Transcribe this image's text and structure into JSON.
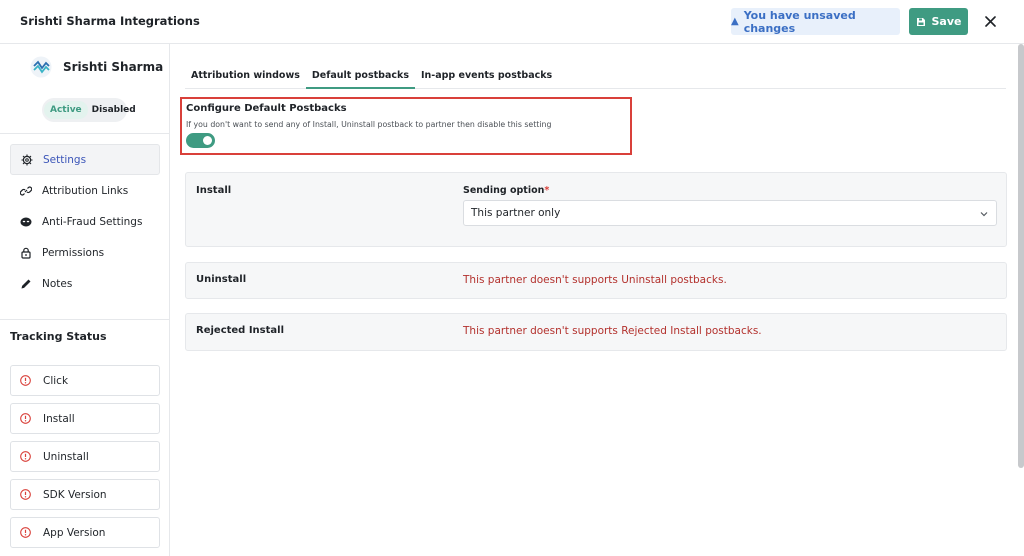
{
  "header": {
    "title": "Srishti Sharma Integrations",
    "unsaved_icon": "▲",
    "unsaved_text": "You have unsaved changes",
    "save_label": "Save",
    "close_icon": "close-icon"
  },
  "sidebar": {
    "brand_name": "Srishti Sharma",
    "status": {
      "active": "Active",
      "disabled": "Disabled"
    },
    "nav": [
      {
        "label": "Settings",
        "icon": "gear-icon",
        "active": true
      },
      {
        "label": "Attribution Links",
        "icon": "link-icon",
        "active": false
      },
      {
        "label": "Anti-Fraud Settings",
        "icon": "shield-icon",
        "active": false
      },
      {
        "label": "Permissions",
        "icon": "lock-icon",
        "active": false
      },
      {
        "label": "Notes",
        "icon": "pencil-icon",
        "active": false
      }
    ],
    "tracking_title": "Tracking Status",
    "tracking": [
      {
        "label": "Click",
        "icon": "alert-icon"
      },
      {
        "label": "Install",
        "icon": "alert-icon"
      },
      {
        "label": "Uninstall",
        "icon": "alert-icon"
      },
      {
        "label": "SDK Version",
        "icon": "alert-icon"
      },
      {
        "label": "App Version",
        "icon": "alert-icon"
      }
    ]
  },
  "tabs": [
    {
      "label": "Attribution windows",
      "active": false
    },
    {
      "label": "Default postbacks",
      "active": true
    },
    {
      "label": "In-app events postbacks",
      "active": false
    }
  ],
  "config": {
    "title": "Configure Default Postbacks",
    "description": "If you don't want to send any of Install, Uninstall postback to partner then disable this setting",
    "enabled": true
  },
  "rows": {
    "install": {
      "label": "Install",
      "sending_label": "Sending option",
      "required_mark": "*",
      "selected": "This partner only"
    },
    "uninstall": {
      "label": "Uninstall",
      "message": "This partner doesn't supports Uninstall postbacks."
    },
    "rejected": {
      "label": "Rejected Install",
      "message": "This partner doesn't supports Rejected Install postbacks."
    }
  },
  "colors": {
    "accent": "#3f9b82",
    "error": "#b3312d",
    "highlight_border": "#d9403a",
    "link_blue": "#3b55b8"
  }
}
